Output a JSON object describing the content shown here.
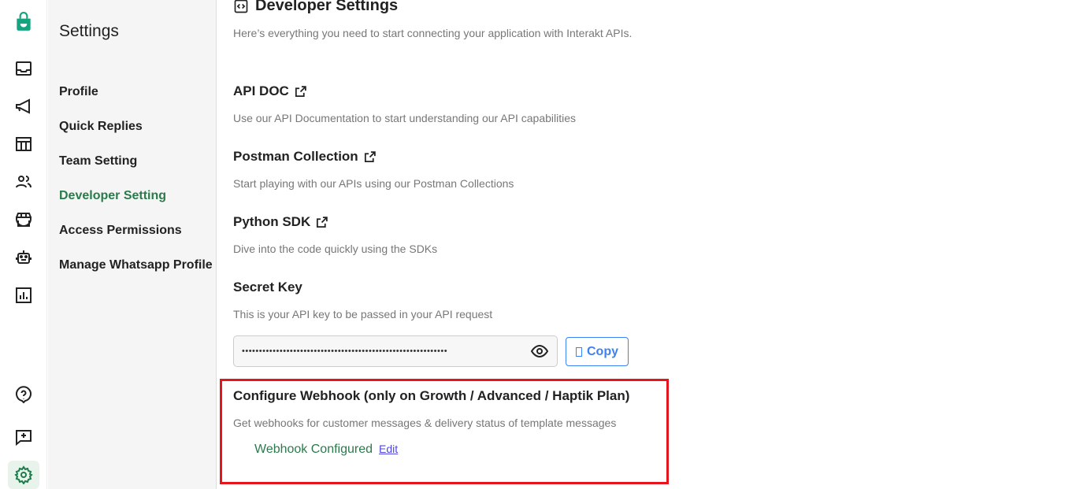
{
  "colors": {
    "accent": "#2b7a4b",
    "brand": "#16a37f",
    "highlight": "#e8141d",
    "link": "#3b82f6"
  },
  "rail": [
    "inbox-icon",
    "megaphone-icon",
    "table-icon",
    "contacts-icon",
    "store-icon",
    "bot-icon",
    "analytics-icon",
    "help-icon",
    "feedback-icon",
    "settings-icon"
  ],
  "sidebar": {
    "title": "Settings",
    "items": [
      {
        "label": "Profile"
      },
      {
        "label": "Quick Replies"
      },
      {
        "label": "Team Setting"
      },
      {
        "label": "Developer Setting",
        "active": true
      },
      {
        "label": "Access Permissions"
      },
      {
        "label": "Manage Whatsapp Profile"
      }
    ]
  },
  "main": {
    "title": "Developer Settings",
    "subtitle": "Here’s everything you need to start connecting your application with Interakt APIs.",
    "sections": [
      {
        "title": "API DOC",
        "desc": "Use our API Documentation to start understanding our API capabilities"
      },
      {
        "title": "Postman Collection",
        "desc": "Start playing with our APIs using our Postman Collections"
      },
      {
        "title": "Python SDK",
        "desc": "Dive into the code quickly using the SDKs"
      },
      {
        "title": "Secret Key",
        "desc": "This is your API key to be passed in your API request"
      }
    ],
    "secret_key_masked": "••••••••••••••••••••••••••••••••••••••••••••••••••••••••••••",
    "copy_label": "Copy",
    "webhook": {
      "title": "Configure Webhook (only on Growth / Advanced / Haptik Plan)",
      "desc": "Get webhooks for customer messages & delivery status of template messages",
      "status": "Webhook Configured",
      "edit": "Edit"
    }
  }
}
